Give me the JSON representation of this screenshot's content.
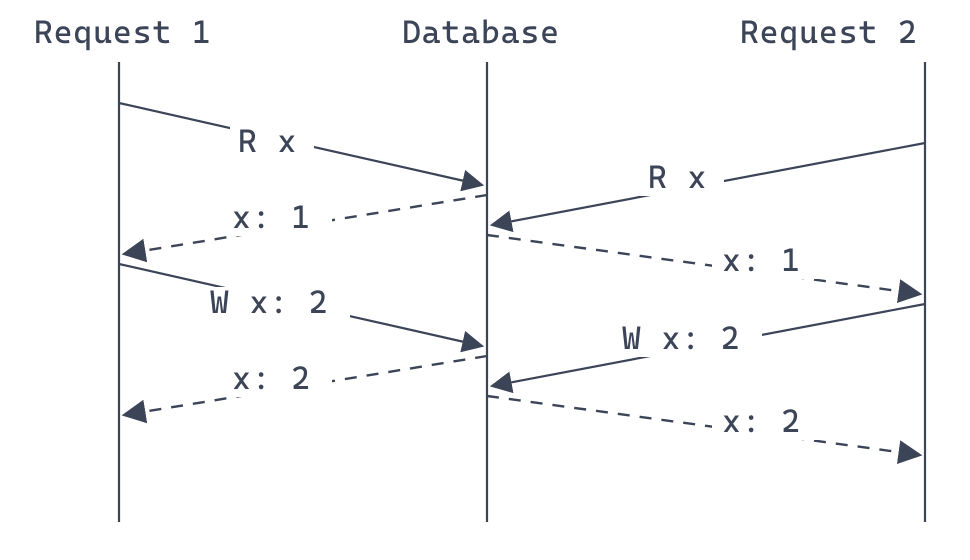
{
  "diagram": {
    "participants": {
      "p1": "Request 1",
      "db": "Database",
      "p2": "Request 2"
    },
    "messages": {
      "m1": "R x",
      "m2": "R x",
      "m3": "x: 1",
      "m4": "x: 1",
      "m5": "W x: 2",
      "m6": "W x: 2",
      "m7": "x: 2",
      "m8": "x: 2"
    }
  }
}
